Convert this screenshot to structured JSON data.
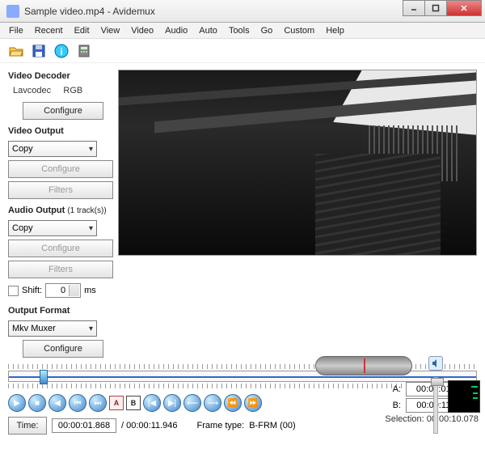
{
  "title": "Sample video.mp4 - Avidemux",
  "menu": [
    "File",
    "Recent",
    "Edit",
    "View",
    "Video",
    "Audio",
    "Auto",
    "Tools",
    "Go",
    "Custom",
    "Help"
  ],
  "decoder": {
    "heading": "Video Decoder",
    "codec": "Lavcodec",
    "colorspace": "RGB",
    "configure": "Configure"
  },
  "video_out": {
    "heading": "Video Output",
    "mode": "Copy",
    "configure": "Configure",
    "filters": "Filters"
  },
  "audio_out": {
    "heading": "Audio Output",
    "tracks_note": "(1 track(s))",
    "mode": "Copy",
    "configure": "Configure",
    "filters": "Filters",
    "shift_label": "Shift:",
    "shift_value": "0",
    "shift_unit": "ms"
  },
  "output_format": {
    "heading": "Output Format",
    "muxer": "Mkv Muxer",
    "configure": "Configure"
  },
  "time": {
    "label": "Time:",
    "current": "00:00:01.868",
    "total": "/ 00:00:11.946"
  },
  "frame_type": {
    "label": "Frame type:",
    "value": "B-FRM (00)"
  },
  "ab": {
    "a_label": "A:",
    "a_value": "00:00:01.868",
    "b_label": "B:",
    "b_value": "00:00:11.946",
    "selection_label": "Selection:",
    "selection_value": "00:00:10.078"
  }
}
